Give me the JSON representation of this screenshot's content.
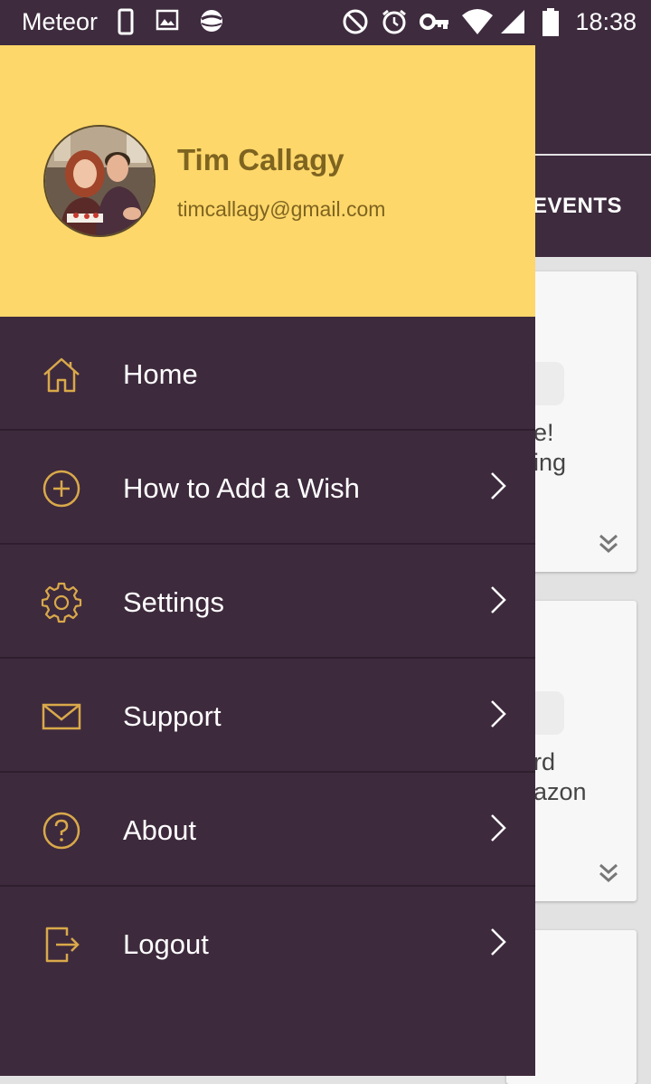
{
  "status_bar": {
    "carrier": "Meteor",
    "time": "18:38",
    "left_icons": [
      "phone-icon",
      "image-icon",
      "sync-icon"
    ],
    "right_icons": [
      "do-not-disturb-icon",
      "alarm-icon",
      "vpn-key-icon",
      "wifi-icon",
      "signal-icon",
      "battery-icon"
    ]
  },
  "background": {
    "tab_label": "EVENTS",
    "cards": [
      {
        "text": "e!\ning"
      },
      {
        "text": "rd\nazon"
      }
    ]
  },
  "drawer": {
    "header": {
      "name": "Tim Callagy",
      "email": "timcallagy@gmail.com"
    },
    "menu": [
      {
        "label": "Home",
        "icon": "home-icon",
        "has_arrow": false
      },
      {
        "label": "How to Add a Wish",
        "icon": "add-circle-icon",
        "has_arrow": true
      },
      {
        "label": "Settings",
        "icon": "gear-icon",
        "has_arrow": true
      },
      {
        "label": "Support",
        "icon": "mail-icon",
        "has_arrow": true
      },
      {
        "label": "About",
        "icon": "help-circle-icon",
        "has_arrow": true
      },
      {
        "label": "Logout",
        "icon": "logout-icon",
        "has_arrow": true
      }
    ]
  },
  "colors": {
    "drawer_bg": "#3e2a3d",
    "header_bg": "#fed76a",
    "icon_accent": "#d9a94a",
    "name_text": "#7e6420"
  }
}
